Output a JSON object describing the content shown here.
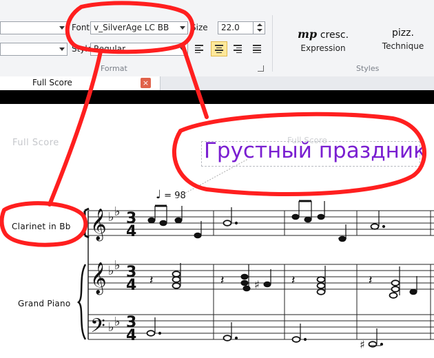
{
  "ribbon": {
    "font_label": "Font",
    "font_value": "v_SilverAge LC BB",
    "size_label": "Size",
    "size_value": "22.0",
    "style_label": "Style",
    "style_value": "Regular",
    "format_group": "Format",
    "styles_group": "Styles",
    "expression_glyph": "mp",
    "expression_word": "cresc.",
    "expression_label": "Expression",
    "technique_text": "pizz.",
    "technique_label": "Technique"
  },
  "tab": {
    "title": "Full Score",
    "close_glyph": "×"
  },
  "score": {
    "header_left": "Full Score",
    "header_center": "Full Score",
    "title": "Грустный праздник",
    "tempo_glyph": "♩",
    "tempo_text": "= 98",
    "instruments": [
      "Clarinet in Bb",
      "Grand Piano"
    ],
    "time_signature": [
      "3",
      "4"
    ]
  },
  "colors": {
    "title": "#7a1fd1",
    "annotation": "#ff1f1f",
    "active_button": "#fde89a"
  }
}
